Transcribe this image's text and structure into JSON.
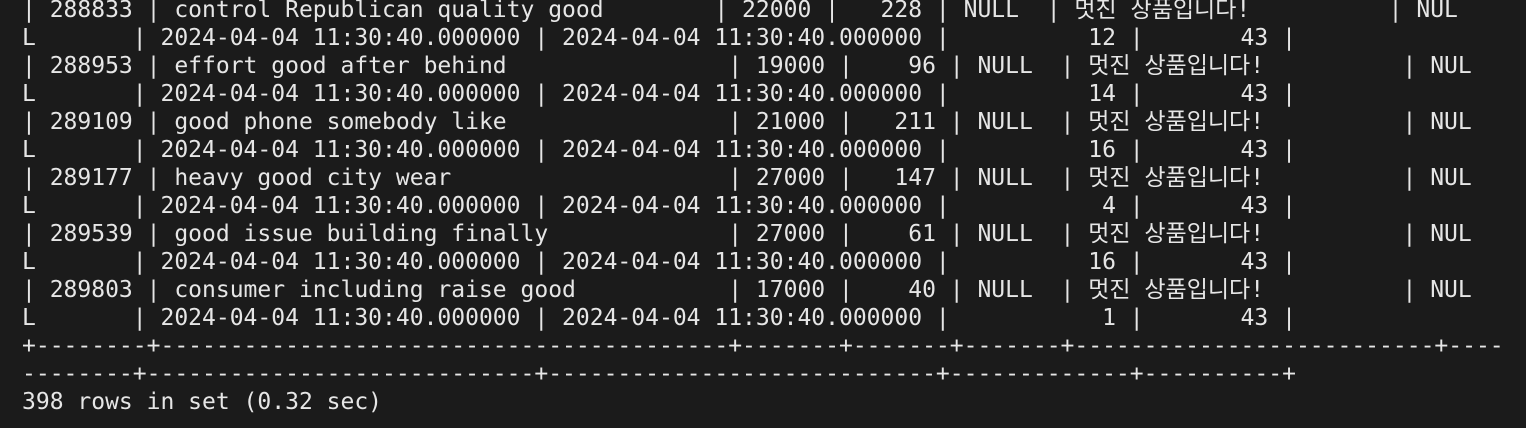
{
  "terminal": {
    "lines": [
      "| 288833 | control Republican quality good        | 22000 |   228 | NULL  | 멋진 상품입니다!          | NUL",
      "L       | 2024-04-04 11:30:40.000000 | 2024-04-04 11:30:40.000000 |          12 |       43 |",
      "| 288953 | effort good after behind                | 19000 |    96 | NULL  | 멋진 상품입니다!          | NUL",
      "L       | 2024-04-04 11:30:40.000000 | 2024-04-04 11:30:40.000000 |          14 |       43 |",
      "| 289109 | good phone somebody like                | 21000 |   211 | NULL  | 멋진 상품입니다!          | NUL",
      "L       | 2024-04-04 11:30:40.000000 | 2024-04-04 11:30:40.000000 |          16 |       43 |",
      "| 289177 | heavy good city wear                    | 27000 |   147 | NULL  | 멋진 상품입니다!          | NUL",
      "L       | 2024-04-04 11:30:40.000000 | 2024-04-04 11:30:40.000000 |           4 |       43 |",
      "| 289539 | good issue building finally             | 27000 |    61 | NULL  | 멋진 상품입니다!          | NUL",
      "L       | 2024-04-04 11:30:40.000000 | 2024-04-04 11:30:40.000000 |          16 |       43 |",
      "| 289803 | consumer including raise good           | 17000 |    40 | NULL  | 멋진 상품입니다!          | NUL",
      "L       | 2024-04-04 11:30:40.000000 | 2024-04-04 11:30:40.000000 |           1 |       43 |",
      "+--------+-----------------------------------------+-------+-------+-------+--------------------------+----",
      "--------+----------------------------+----------------------------+-------------+----------+",
      "398 rows in set (0.32 sec)"
    ]
  }
}
